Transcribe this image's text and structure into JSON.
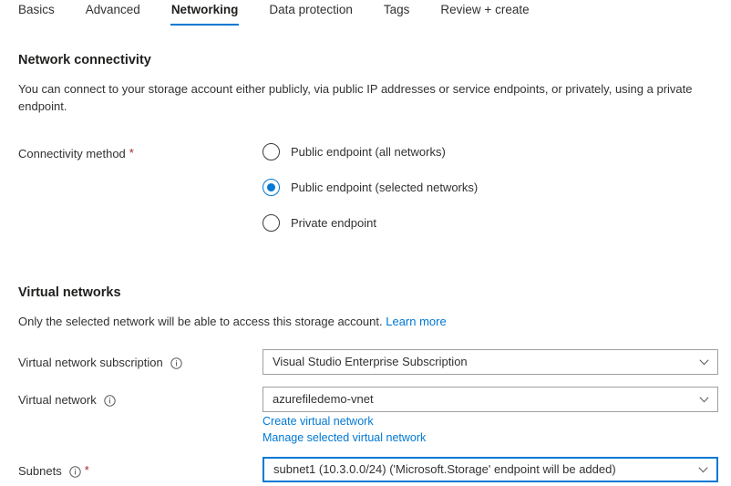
{
  "tabs": [
    {
      "label": "Basics",
      "active": false
    },
    {
      "label": "Advanced",
      "active": false
    },
    {
      "label": "Networking",
      "active": true
    },
    {
      "label": "Data protection",
      "active": false
    },
    {
      "label": "Tags",
      "active": false
    },
    {
      "label": "Review + create",
      "active": false
    }
  ],
  "network_connectivity": {
    "title": "Network connectivity",
    "description": "You can connect to your storage account either publicly, via public IP addresses or service endpoints, or privately, using a private endpoint.",
    "connectivity_method": {
      "label": "Connectivity method",
      "required_marker": "*",
      "options": [
        {
          "label": "Public endpoint (all networks)",
          "selected": false
        },
        {
          "label": "Public endpoint (selected networks)",
          "selected": true
        },
        {
          "label": "Private endpoint",
          "selected": false
        }
      ]
    }
  },
  "virtual_networks": {
    "title": "Virtual networks",
    "description": "Only the selected network will be able to access this storage account.",
    "learn_more_label": "Learn more",
    "fields": {
      "subscription": {
        "label": "Virtual network subscription",
        "info_icon": "info-icon",
        "value": "Visual Studio Enterprise Subscription",
        "chevron_icon": "chevron-down-icon"
      },
      "virtual_network": {
        "label": "Virtual network",
        "info_icon": "info-icon",
        "value": "azurefiledemo-vnet",
        "chevron_icon": "chevron-down-icon"
      },
      "subnets": {
        "label": "Subnets",
        "info_icon": "info-icon",
        "required_marker": "*",
        "value": "subnet1 (10.3.0.0/24) ('Microsoft.Storage' endpoint will be added)",
        "chevron_icon": "chevron-down-icon"
      }
    },
    "links": [
      {
        "label": "Create virtual network"
      },
      {
        "label": "Manage selected virtual network"
      }
    ]
  },
  "colors": {
    "accent": "#0078d4",
    "required": "#a4262c",
    "text": "#323130",
    "border": "#a19f9d",
    "background": "#ffffff"
  }
}
